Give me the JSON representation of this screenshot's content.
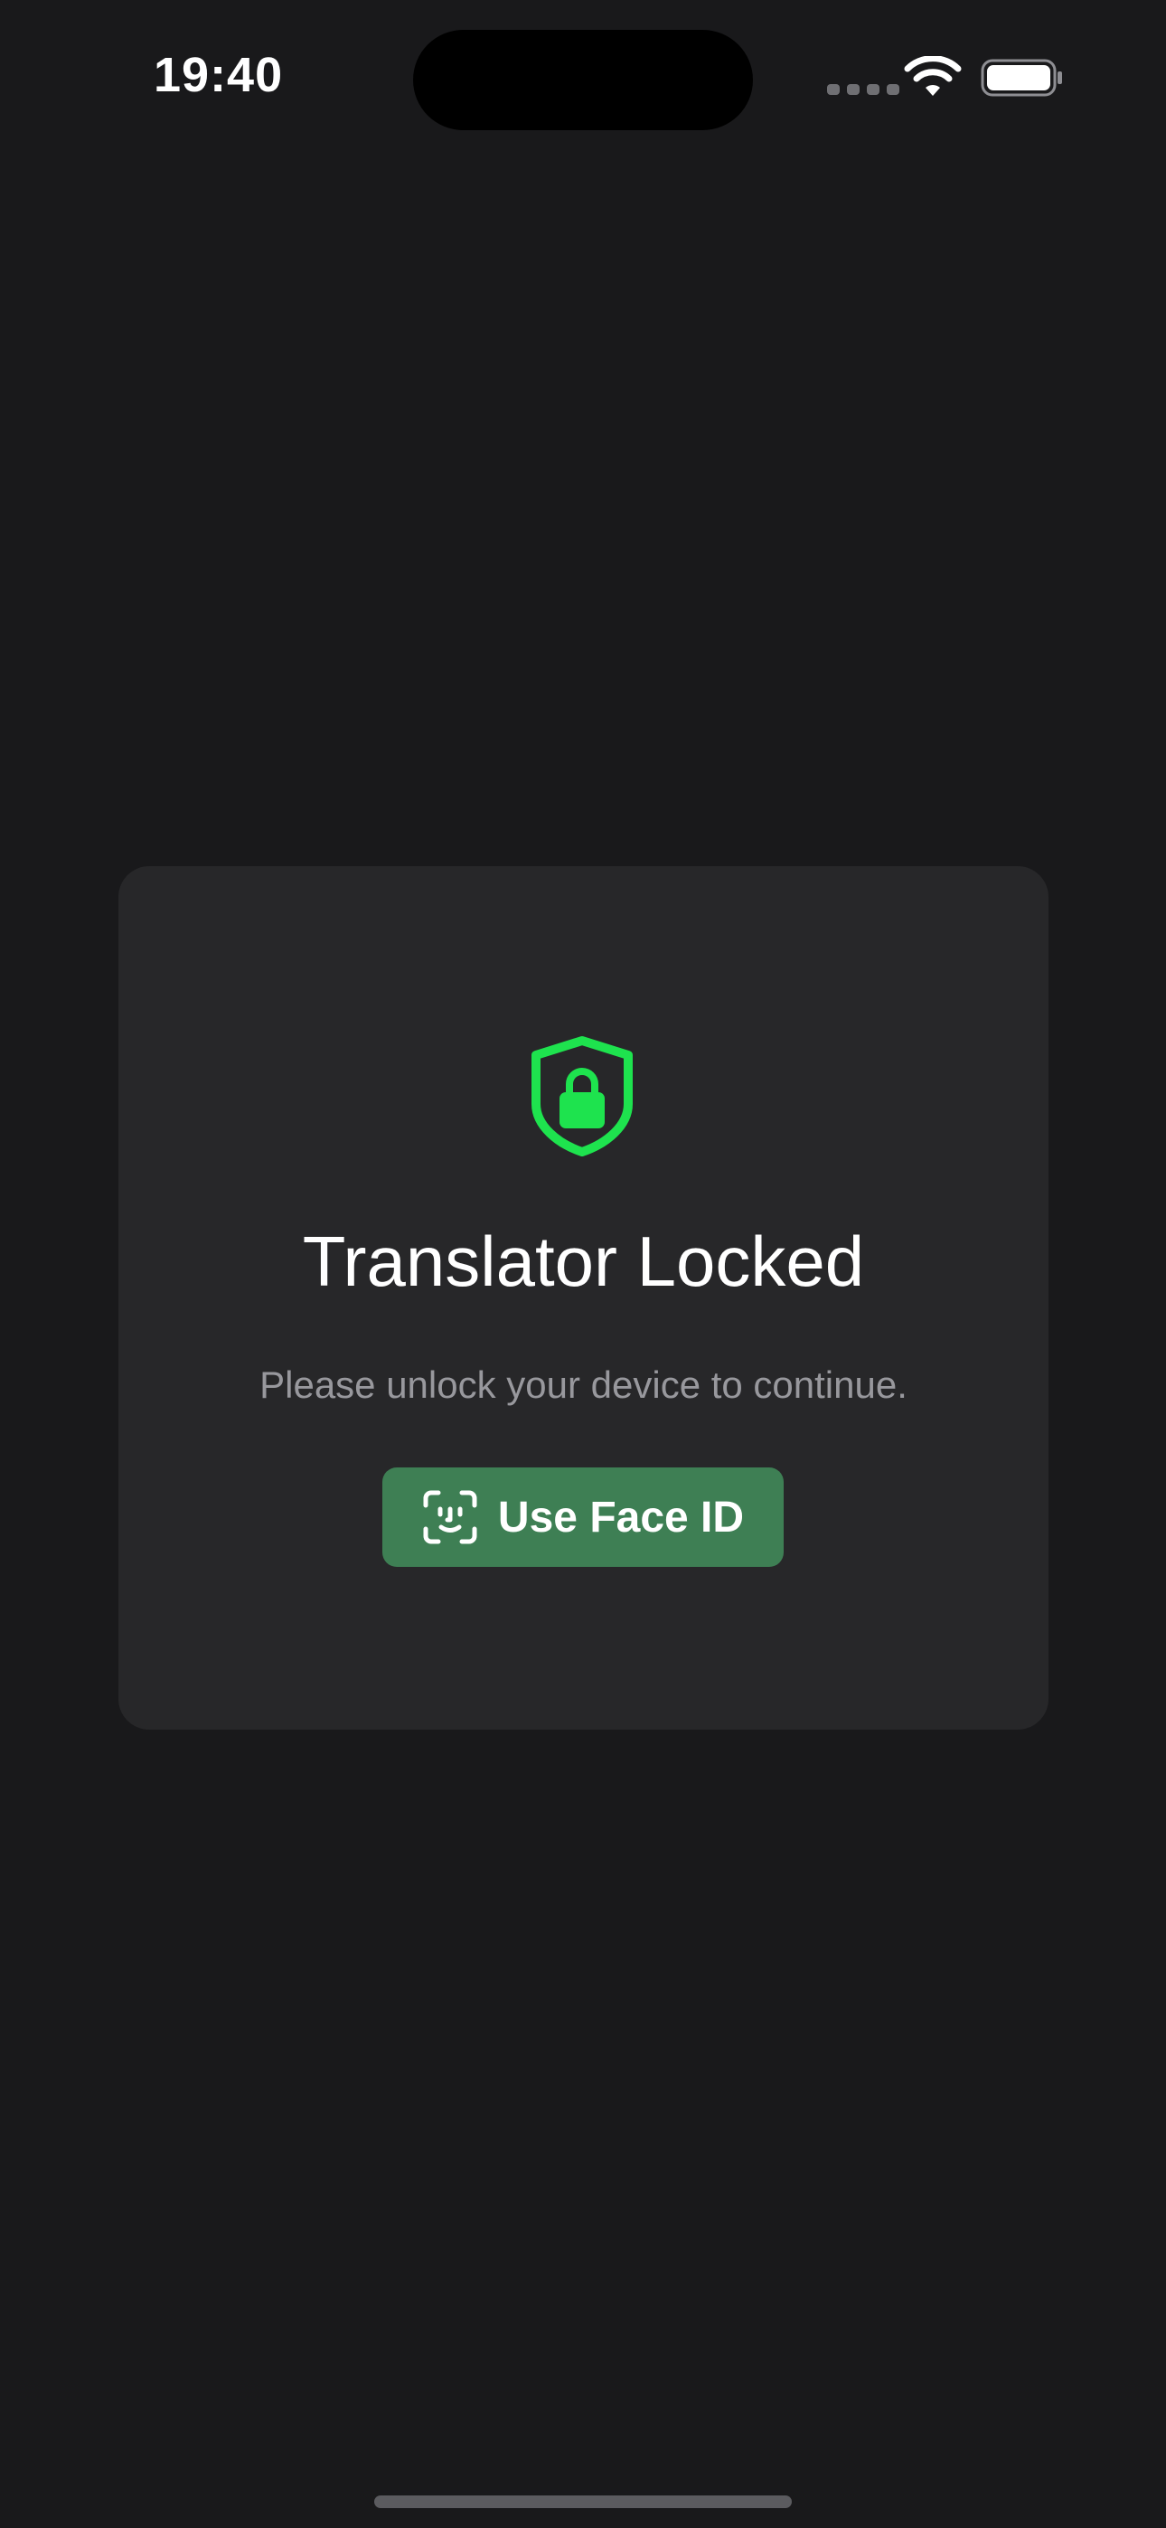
{
  "status_bar": {
    "time": "19:40"
  },
  "lock_screen": {
    "icon": "shield-lock-icon",
    "title": "Translator Locked",
    "subtitle": "Please unlock your device to continue.",
    "button_label": "Use Face ID",
    "button_icon": "faceid-icon"
  },
  "colors": {
    "background": "#19191b",
    "card": "#272729",
    "accent_green": "#1ee34e",
    "button_green": "#3e7f54",
    "subtitle_gray": "#98989d"
  }
}
